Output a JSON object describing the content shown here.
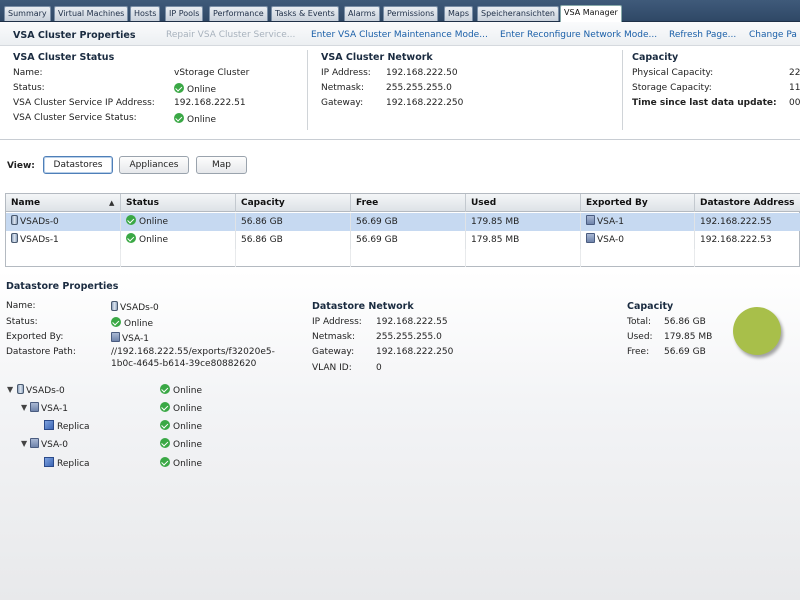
{
  "tabs": [
    {
      "label": "Summary",
      "active": false
    },
    {
      "label": "Virtual Machines",
      "active": false
    },
    {
      "label": "Hosts",
      "active": false
    },
    {
      "label": "IP Pools",
      "active": false
    },
    {
      "label": "Performance",
      "active": false
    },
    {
      "label": "Tasks & Events",
      "active": false
    },
    {
      "label": "Alarms",
      "active": false
    },
    {
      "label": "Permissions",
      "active": false
    },
    {
      "label": "Maps",
      "active": false
    },
    {
      "label": "Speicheransichten",
      "active": false
    },
    {
      "label": "VSA Manager",
      "active": true
    }
  ],
  "cluster": {
    "title": "VSA Cluster Properties",
    "actions": {
      "repair": "Repair VSA Cluster Service...",
      "maintenance": "Enter VSA Cluster Maintenance Mode...",
      "reconfigure": "Enter Reconfigure Network Mode...",
      "refresh": "Refresh Page...",
      "change": "Change Pa"
    },
    "status": {
      "title": "VSA Cluster Status",
      "name_label": "Name:",
      "name_value": "vStorage Cluster",
      "status_label": "Status:",
      "status_value": "Online",
      "ip_label": "VSA Cluster Service IP Address:",
      "ip_value": "192.168.222.51",
      "svc_label": "VSA Cluster Service Status:",
      "svc_value": "Online"
    },
    "network": {
      "title": "VSA Cluster Network",
      "ip_label": "IP Address:",
      "ip_value": "192.168.222.50",
      "netmask_label": "Netmask:",
      "netmask_value": "255.255.255.0",
      "gateway_label": "Gateway:",
      "gateway_value": "192.168.222.250"
    },
    "capacity": {
      "title": "Capacity",
      "physical_label": "Physical Capacity:",
      "physical_value": "22",
      "storage_label": "Storage Capacity:",
      "storage_value": "11",
      "update_label": "Time since last data update:",
      "update_value": "00"
    }
  },
  "view": {
    "label": "View:",
    "buttons": {
      "datastores": "Datastores",
      "appliances": "Appliances",
      "map": "Map"
    }
  },
  "table": {
    "columns": [
      "Name",
      "Status",
      "Capacity",
      "Free",
      "Used",
      "Exported By",
      "Datastore Address"
    ],
    "sort_indicator": "▲",
    "rows": [
      {
        "name": "VSADs-0",
        "status": "Online",
        "capacity": "56.86 GB",
        "free": "56.69 GB",
        "used": "179.85 MB",
        "exported_by": "VSA-1",
        "address": "192.168.222.55",
        "selected": true
      },
      {
        "name": "VSADs-1",
        "status": "Online",
        "capacity": "56.86 GB",
        "free": "56.69 GB",
        "used": "179.85 MB",
        "exported_by": "VSA-0",
        "address": "192.168.222.53",
        "selected": false
      }
    ]
  },
  "datastore": {
    "title": "Datastore Properties",
    "name_label": "Name:",
    "name_value": "VSADs-0",
    "status_label": "Status:",
    "status_value": "Online",
    "exported_label": "Exported By:",
    "exported_value": "VSA-1",
    "path_label": "Datastore Path:",
    "path_line1": "//192.168.222.55/exports/f32020e5-",
    "path_line2": "1b0c-4645-b614-39ce80882620",
    "network": {
      "title": "Datastore Network",
      "ip_label": "IP Address:",
      "ip_value": "192.168.222.55",
      "netmask_label": "Netmask:",
      "netmask_value": "255.255.255.0",
      "gateway_label": "Gateway:",
      "gateway_value": "192.168.222.250",
      "vlan_label": "VLAN ID:",
      "vlan_value": "0"
    },
    "capacity": {
      "title": "Capacity",
      "total_label": "Total:",
      "total_value": "56.86 GB",
      "used_label": "Used:",
      "used_value": "179.85 MB",
      "free_label": "Free:",
      "free_value": "56.69 GB",
      "pie_color": "#a8bf4a"
    },
    "tree": [
      {
        "label": "VSADs-0",
        "status": "Online"
      },
      {
        "label": "VSA-1",
        "status": "Online"
      },
      {
        "label": "Replica",
        "status": "Online"
      },
      {
        "label": "VSA-0",
        "status": "Online"
      },
      {
        "label": "Replica",
        "status": "Online"
      }
    ]
  }
}
